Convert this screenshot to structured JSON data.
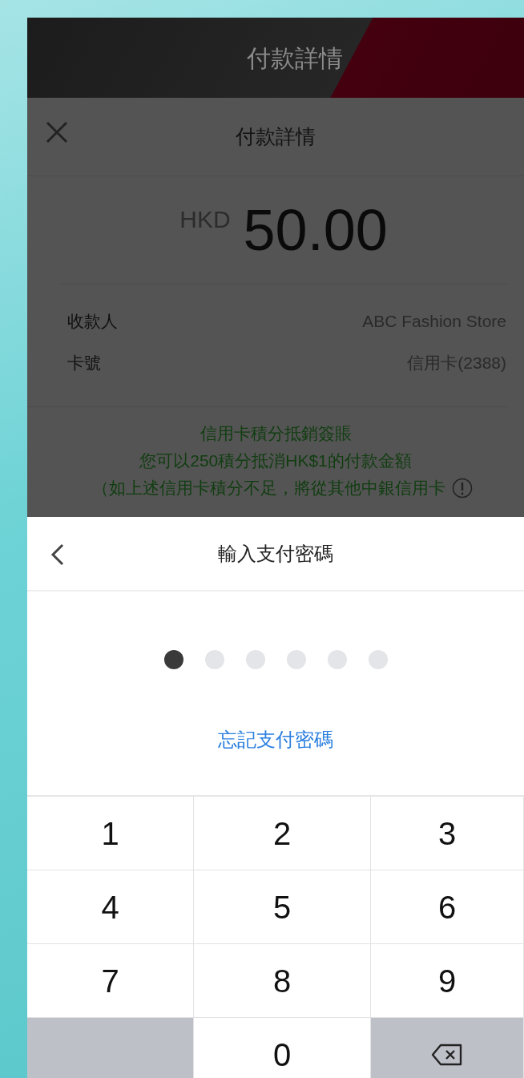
{
  "app_bar": {
    "title": "付款詳情"
  },
  "details": {
    "title": "付款詳情",
    "currency": "HKD",
    "amount": "50.00",
    "rows": [
      {
        "label": "收款人",
        "value": "ABC Fashion Store"
      },
      {
        "label": "卡號",
        "value": "信用卡(2388)"
      }
    ],
    "notice": [
      "信用卡積分抵銷簽賬",
      "您可以250積分抵消HK$1的付款金額",
      "（如上述信用卡積分不足，將從其他中銀信用卡"
    ]
  },
  "pin_sheet": {
    "title": "輸入支付密碼",
    "digits": [
      {
        "filled": true
      },
      {
        "filled": false
      },
      {
        "filled": false
      },
      {
        "filled": false
      },
      {
        "filled": false
      },
      {
        "filled": false
      }
    ],
    "forgot_link": "忘記支付密碼"
  },
  "keypad": {
    "keys": [
      {
        "kind": "digit",
        "label": "1"
      },
      {
        "kind": "digit",
        "label": "2"
      },
      {
        "kind": "digit",
        "label": "3"
      },
      {
        "kind": "digit",
        "label": "4"
      },
      {
        "kind": "digit",
        "label": "5"
      },
      {
        "kind": "digit",
        "label": "6"
      },
      {
        "kind": "digit",
        "label": "7"
      },
      {
        "kind": "digit",
        "label": "8"
      },
      {
        "kind": "digit",
        "label": "9"
      },
      {
        "kind": "blank"
      },
      {
        "kind": "digit",
        "label": "0"
      },
      {
        "kind": "backspace"
      }
    ]
  }
}
